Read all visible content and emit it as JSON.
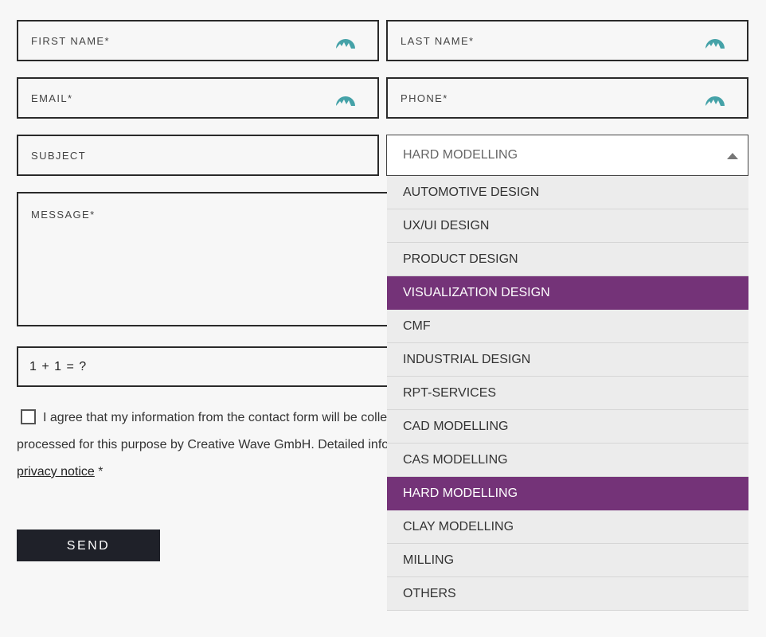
{
  "form": {
    "first_name_placeholder": "FIRST NAME*",
    "last_name_placeholder": "LAST NAME*",
    "email_placeholder": "EMAIL*",
    "phone_placeholder": "PHONE*",
    "subject_placeholder": "SUBJECT",
    "message_placeholder": "MESSAGE*",
    "captcha_label": "1 + 1 = ?",
    "consent_line1": "I agree that my information from the contact form will be collected and",
    "consent_line2": "processed for this purpose by Creative Wave GmbH. Detailed information in the",
    "privacy_link": "privacy notice",
    "consent_suffix": " *",
    "send_label": "SEND"
  },
  "topic_select": {
    "selected": "HARD MODELLING",
    "options": [
      {
        "label": "AUTOMOTIVE DESIGN",
        "highlighted": false
      },
      {
        "label": "UX/UI DESIGN",
        "highlighted": false
      },
      {
        "label": "PRODUCT DESIGN",
        "highlighted": false
      },
      {
        "label": "VISUALIZATION DESIGN",
        "highlighted": true
      },
      {
        "label": "CMF",
        "highlighted": false
      },
      {
        "label": "INDUSTRIAL DESIGN",
        "highlighted": false
      },
      {
        "label": "RPT-SERVICES",
        "highlighted": false
      },
      {
        "label": "CAD MODELLING",
        "highlighted": false
      },
      {
        "label": "CAS MODELLING",
        "highlighted": false
      },
      {
        "label": "HARD MODELLING",
        "highlighted": true
      },
      {
        "label": "CLAY MODELLING",
        "highlighted": false
      },
      {
        "label": "MILLING",
        "highlighted": false
      },
      {
        "label": "OTHERS",
        "highlighted": false
      }
    ]
  },
  "colors": {
    "highlight": "#743378",
    "autofill_icon": "#45a2a8",
    "button_bg": "#1f2129"
  },
  "icons": {
    "autofill": "password-manager-icon",
    "caret": "caret-up-icon"
  }
}
